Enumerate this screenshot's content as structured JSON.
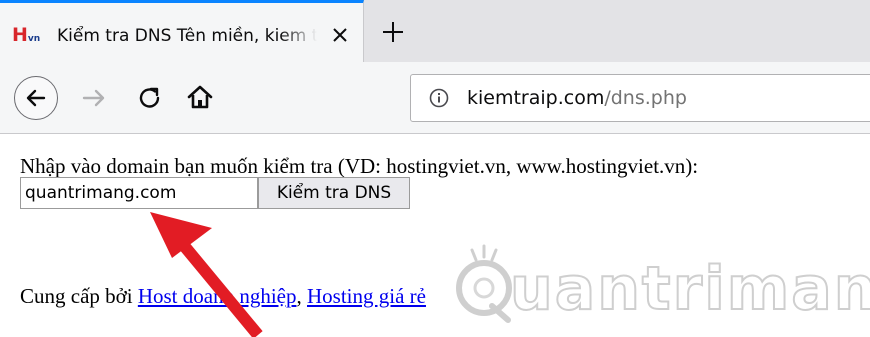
{
  "browser": {
    "tab": {
      "favicon_text": "H",
      "favicon_sub": "vn",
      "title": "Kiểm tra DNS Tên miền, kiem tra dns"
    },
    "url": {
      "domain": "kiemtraip.com",
      "path": "/dns.php"
    }
  },
  "page": {
    "prompt": "Nhập vào domain bạn muốn kiểm tra (VD: hostingviet.vn, www.hostingviet.vn):",
    "input_value": "quantrimang.com",
    "button_label": "Kiểm tra DNS",
    "provided_prefix": "Cung cấp bởi ",
    "links": [
      {
        "label": "Host doanh nghiệp"
      },
      {
        "label": "Hosting giá rẻ"
      }
    ],
    "separator": ", "
  },
  "watermark": {
    "text": "uantrimang"
  },
  "colors": {
    "tab_accent": "#0a84ff",
    "favicon_red": "#d8262b",
    "link": "#0000ee",
    "arrow": "#e21c24"
  },
  "icons": [
    "close-icon",
    "plus-icon",
    "back-arrow-icon",
    "forward-arrow-icon",
    "reload-icon",
    "home-icon",
    "info-icon"
  ]
}
